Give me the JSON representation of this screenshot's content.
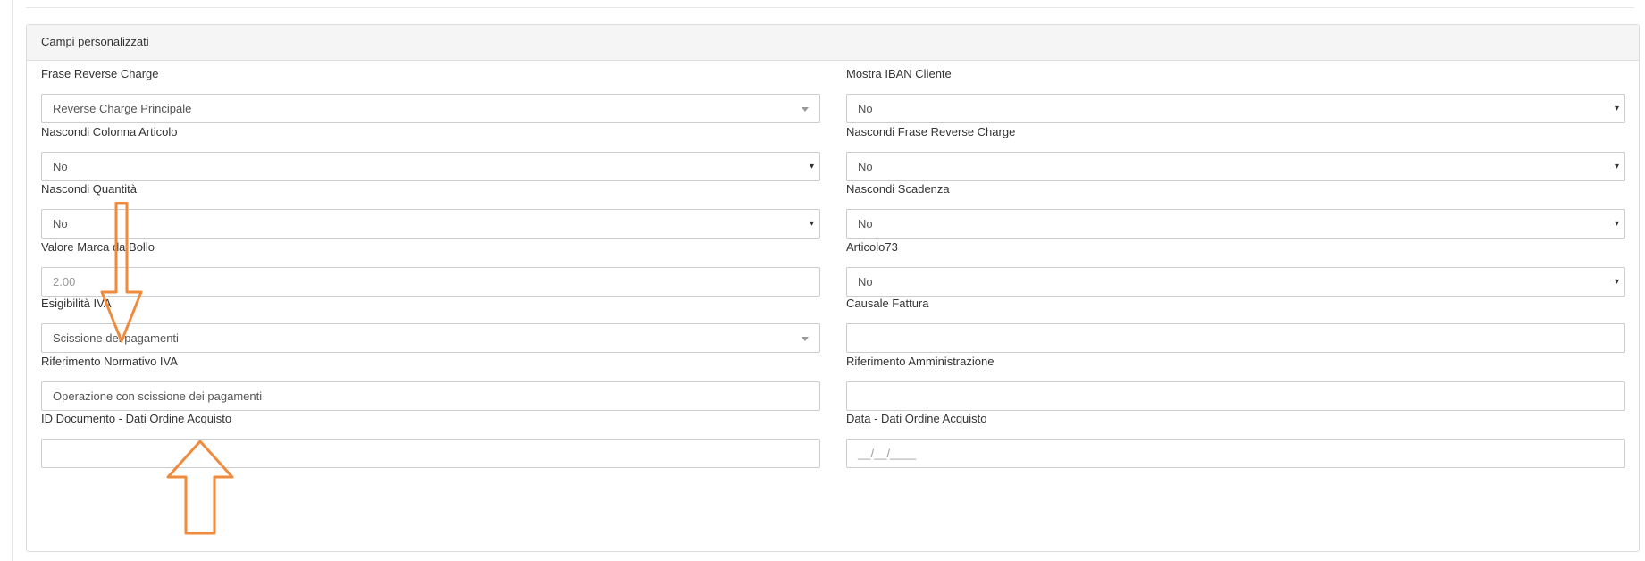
{
  "panel": {
    "title": "Campi personalizzati"
  },
  "left_fields": [
    {
      "label": "Frase Reverse Charge",
      "value": "Reverse Charge Principale",
      "type": "select2"
    },
    {
      "label": "Nascondi Colonna Articolo",
      "value": "No",
      "type": "select"
    },
    {
      "label": "Nascondi Quantità",
      "value": "No",
      "type": "select"
    },
    {
      "label": "Valore Marca da Bollo",
      "value": "2.00",
      "type": "input-placeholder"
    },
    {
      "label": "Esigibilità IVA",
      "value": "Scissione dei pagamenti",
      "type": "select2"
    },
    {
      "label": "Riferimento Normativo IVA",
      "value": "Operazione con scissione dei pagamenti",
      "type": "input"
    },
    {
      "label": "ID Documento - Dati Ordine Acquisto",
      "value": "",
      "type": "input"
    }
  ],
  "right_fields": [
    {
      "label": "Mostra IBAN Cliente",
      "value": "No",
      "type": "select"
    },
    {
      "label": "Nascondi Frase Reverse Charge",
      "value": "No",
      "type": "select"
    },
    {
      "label": "Nascondi Scadenza",
      "value": "No",
      "type": "select"
    },
    {
      "label": "Articolo73",
      "value": "No",
      "type": "select"
    },
    {
      "label": "Causale Fattura",
      "value": "",
      "type": "input"
    },
    {
      "label": "Riferimento Amministrazione",
      "value": "",
      "type": "input"
    },
    {
      "label": "Data - Dati Ordine Acquisto",
      "value": "__/__/____",
      "type": "input-placeholder"
    }
  ],
  "icons": {
    "select_caret": "caret-down-icon",
    "dark_caret": "▾"
  },
  "annotations": {
    "color": "#f08a3c",
    "down_arrow": "down-arrow-annotation",
    "up_arrow": "up-arrow-annotation"
  }
}
